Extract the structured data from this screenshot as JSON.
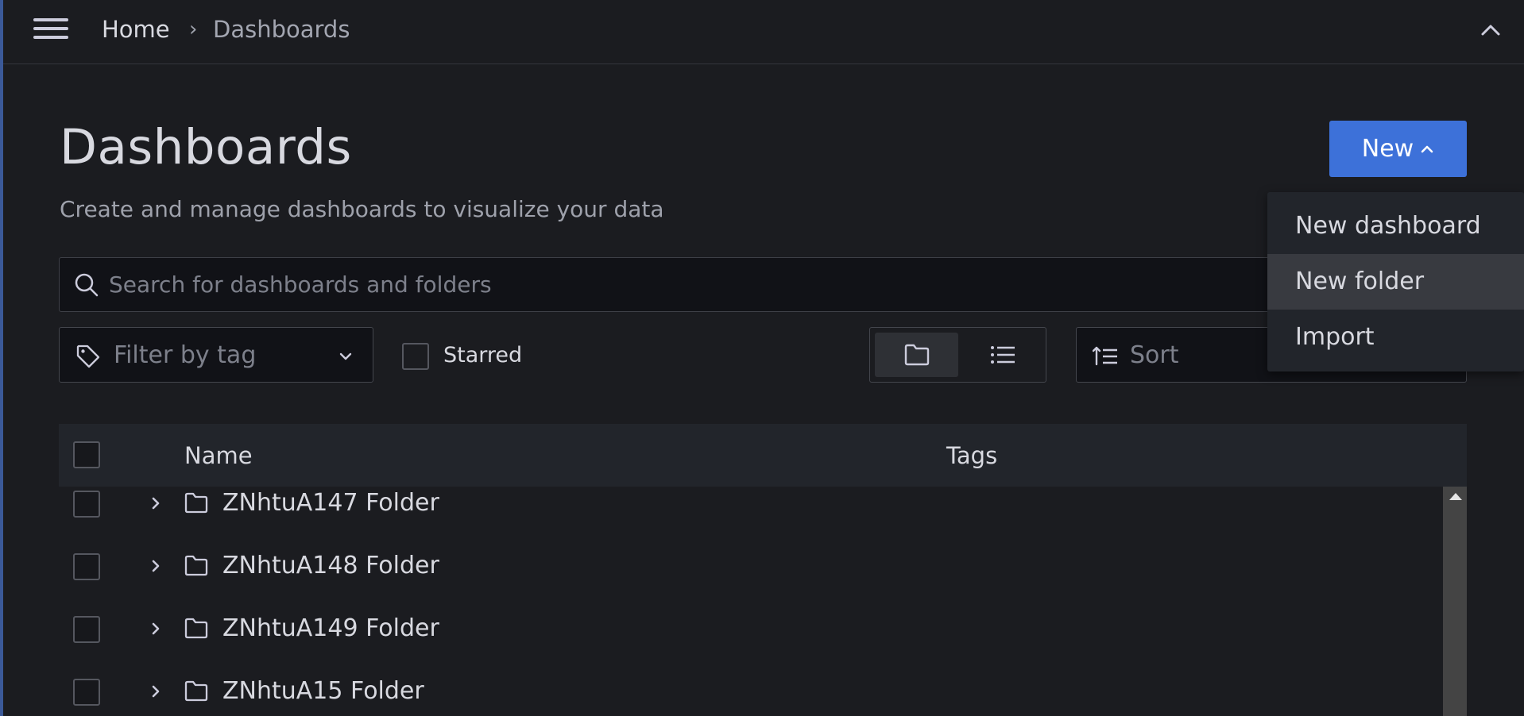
{
  "breadcrumb": {
    "home": "Home",
    "separator": "›",
    "current": "Dashboards"
  },
  "page": {
    "title": "Dashboards",
    "subtitle": "Create and manage dashboards to visualize your data"
  },
  "new_button": {
    "label": "New"
  },
  "new_menu": {
    "items": [
      {
        "label": "New dashboard"
      },
      {
        "label": "New folder"
      },
      {
        "label": "Import"
      }
    ]
  },
  "search": {
    "placeholder": "Search for dashboards and folders",
    "value": ""
  },
  "filters": {
    "tag_placeholder": "Filter by tag",
    "starred_label": "Starred",
    "sort_placeholder": "Sort"
  },
  "table": {
    "columns": {
      "name": "Name",
      "tags": "Tags"
    },
    "rows": [
      {
        "label": "ZNhtuA147 Folder"
      },
      {
        "label": "ZNhtuA148 Folder"
      },
      {
        "label": "ZNhtuA149 Folder"
      },
      {
        "label": "ZNhtuA15 Folder"
      }
    ]
  },
  "icons": {
    "menu": "hamburger-menu-icon",
    "collapse": "chevron-up-icon",
    "search": "search-icon",
    "tag": "tag-icon",
    "folder_view": "folder-icon",
    "list_view": "list-icon",
    "sort": "sort-ascending-icon",
    "row_expand": "chevron-right-icon",
    "row_folder": "folder-icon"
  },
  "colors": {
    "primary": "#3d71d9",
    "background": "#1b1c20",
    "panel": "#22252b"
  }
}
